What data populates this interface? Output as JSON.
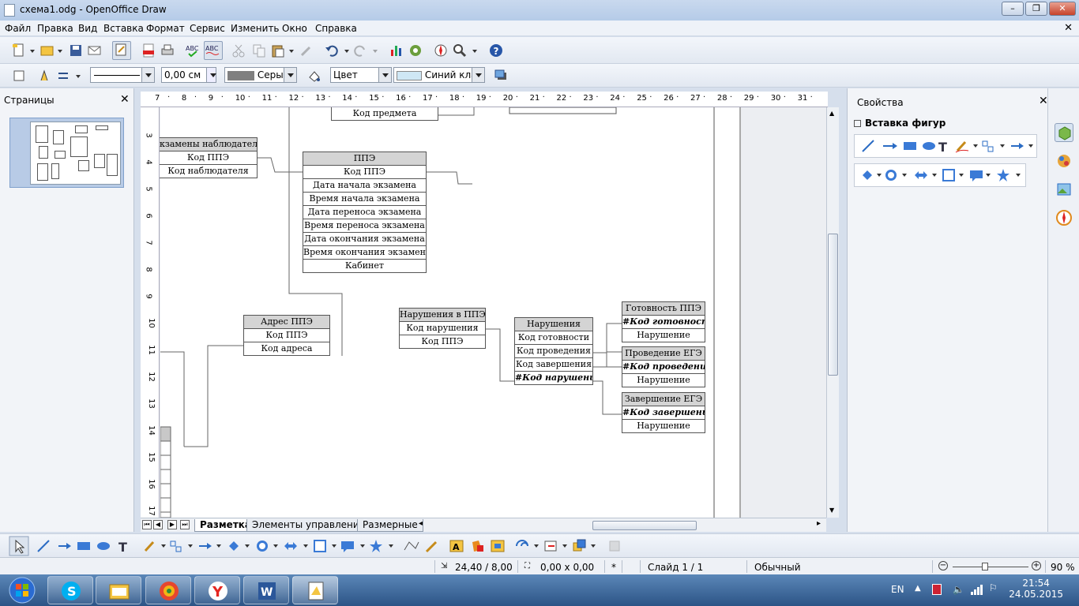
{
  "window": {
    "title": "схема1.odg - OpenOffice Draw"
  },
  "menu": [
    "Файл",
    "Правка",
    "Вид",
    "Вставка",
    "Формат",
    "Сервис",
    "Изменить",
    "Окно",
    "Справка"
  ],
  "toolbar2": {
    "line_width": "0,00 см",
    "fill_color": "Серый",
    "area_style": "Цвет",
    "area_fill": "Синий кла"
  },
  "pages_panel": {
    "title": "Страницы",
    "page_number": "1"
  },
  "ruler": {
    "h": [
      "7",
      "8",
      "9",
      "10",
      "11",
      "12",
      "13",
      "14",
      "15",
      "16",
      "17",
      "18",
      "19",
      "20",
      "21",
      "22",
      "23",
      "24",
      "25",
      "26",
      "27",
      "28",
      "29",
      "30",
      "31"
    ],
    "v": [
      "3",
      "4",
      "5",
      "6",
      "7",
      "8",
      "9",
      "10",
      "11",
      "12",
      "13",
      "14",
      "15",
      "16",
      "17"
    ]
  },
  "tables": {
    "t_subject_top": {
      "rows": [
        "Код предмета"
      ]
    },
    "t_observer": {
      "rows": [
        "кзамены наблюдателя",
        "Код ППЭ",
        "Код наблюдателя"
      ]
    },
    "t_ppe": {
      "header": "ППЭ",
      "rows": [
        "Код ППЭ",
        "Дата начала экзамена",
        "Время начала экзамена",
        "Дата переноса экзамена",
        "Время переноса экзамена",
        "Дата окончания экзамена",
        "Время окончания экзамена",
        "Кабинет"
      ]
    },
    "t_addr": {
      "header": "Адрес ППЭ",
      "rows": [
        "Код ППЭ",
        "Код адреса"
      ]
    },
    "t_viol_ppe": {
      "header": "Нарушения в ППЭ",
      "rows": [
        "Код нарушения",
        "Код ППЭ"
      ]
    },
    "t_viol": {
      "header": "Нарушения",
      "rows": [
        "Код готовности",
        "Код проведения",
        "Код завершения",
        "#Код нарушения"
      ]
    },
    "t_ready": {
      "header": "Готовность ППЭ",
      "rows": [
        "#Код готовности",
        "Нарушение"
      ]
    },
    "t_conduct": {
      "header": "Проведение ЕГЭ",
      "rows": [
        "#Код проведения",
        "Нарушение"
      ]
    },
    "t_finish": {
      "header": "Завершение ЕГЭ",
      "rows": [
        "#Код завершения",
        "Нарушение"
      ]
    }
  },
  "tabs": [
    "Разметка",
    "Элементы управления",
    "Размерные"
  ],
  "sidebar": {
    "title": "Свойства",
    "section": "Вставка фигур"
  },
  "status": {
    "position": "24,40 / 8,00",
    "size": "0,00 x 0,00",
    "modified": "*",
    "slide": "Слайд 1 / 1",
    "layout": "Обычный",
    "zoom": "90 %"
  },
  "tray": {
    "lang": "EN",
    "time": "21:54",
    "date": "24.05.2015"
  }
}
